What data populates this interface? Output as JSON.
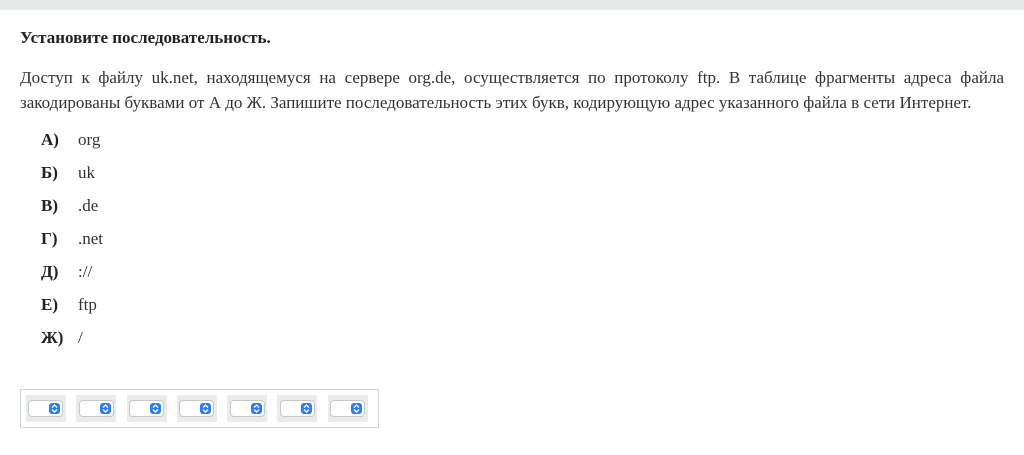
{
  "question": {
    "title": "Установите последовательность.",
    "text": "Доступ к файлу uk.net, находящемуся на сервере  org.de, осуществляется по протоколу  ftp. В таблице фрагменты адреса файла закодированы буквами от А до Ж. Запишите последовательность этих букв, кодирующую адрес указанного файла в сети Интернет."
  },
  "options": [
    {
      "letter": "А)",
      "value": "org"
    },
    {
      "letter": "Б)",
      "value": "uk"
    },
    {
      "letter": "В)",
      "value": ".de"
    },
    {
      "letter": "Г)",
      "value": ".net"
    },
    {
      "letter": "Д)",
      "value": "://"
    },
    {
      "letter": "Е)",
      "value": "ftp"
    },
    {
      "letter": "Ж)",
      "value": "/"
    }
  ],
  "answer": {
    "selects": [
      {
        "selected": ""
      },
      {
        "selected": ""
      },
      {
        "selected": ""
      },
      {
        "selected": ""
      },
      {
        "selected": ""
      },
      {
        "selected": ""
      },
      {
        "selected": ""
      }
    ]
  },
  "icons": {
    "select_arrow": "up-down-chevron-icon"
  },
  "colors": {
    "select_accent": "#2f7df6",
    "top_bar": "#e6e9ea"
  }
}
